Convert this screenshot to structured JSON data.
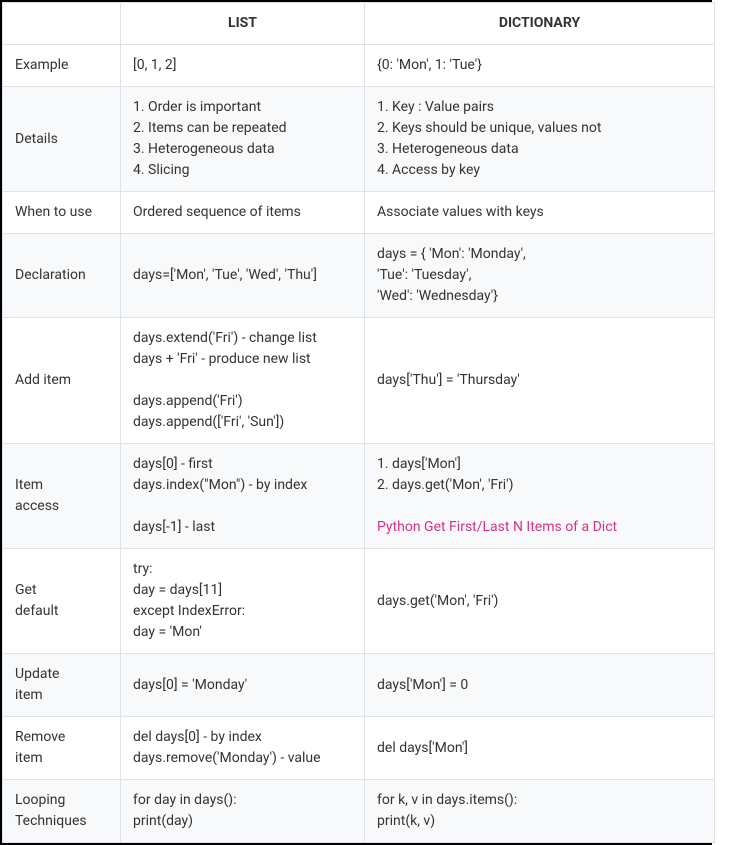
{
  "headers": {
    "col1": "",
    "col2": "LIST",
    "col3": "DICTIONARY"
  },
  "rows": [
    {
      "label": "Example",
      "list": "[0, 1, 2]",
      "dict": "{0: 'Mon', 1: 'Tue'}"
    },
    {
      "label": "Details",
      "list": "1. Order is important\n2. Items can be repeated\n3. Heterogeneous data\n4. Slicing",
      "dict": "1. Key : Value pairs\n2. Keys should be unique, values not\n3. Heterogeneous data\n4. Access by key"
    },
    {
      "label": "When to use",
      "list": "Ordered sequence of items",
      "dict": "Associate values with keys"
    },
    {
      "label": "Declaration",
      "list": "days=['Mon', 'Tue', 'Wed', 'Thu']",
      "dict": "days = { 'Mon': 'Monday',\n'Tue': 'Tuesday',\n'Wed': 'Wednesday'}"
    },
    {
      "label": "Add item",
      "list": "days.extend('Fri') - change list\ndays + 'Fri' - produce new list\n\ndays.append('Fri')\ndays.append(['Fri', 'Sun'])",
      "dict": "days['Thu'] = 'Thursday'"
    },
    {
      "label": "Item\naccess",
      "list": "days[0] - first\ndays.index(\"Mon\") - by index\n\ndays[-1] - last",
      "dict_text": "1. days['Mon']\n2. days.get('Mon', 'Fri')\n",
      "dict_link": "Python Get First/Last N Items of a Dict"
    },
    {
      "label": "Get\ndefault",
      "list": "try:\nday = days[11]\nexcept IndexError:\nday = 'Mon'",
      "dict": "days.get('Mon', 'Fri')"
    },
    {
      "label": "Update\nitem",
      "list": "days[0] = 'Monday'",
      "dict": "days['Mon'] = 0"
    },
    {
      "label": "Remove\nitem",
      "list": "del days[0] - by index\ndays.remove('Monday') - value",
      "dict": "del days['Mon']"
    },
    {
      "label": "Looping\nTechniques",
      "list": "for day in days():\nprint(day)",
      "dict": "for k, v in days.items():\nprint(k, v)"
    }
  ],
  "chart_data": {
    "type": "table",
    "title": "",
    "columns": [
      "",
      "LIST",
      "DICTIONARY"
    ],
    "rows": [
      [
        "Example",
        "[0, 1, 2]",
        "{0: 'Mon', 1: 'Tue'}"
      ],
      [
        "Details",
        "1. Order is important; 2. Items can be repeated; 3. Heterogeneous data; 4. Slicing",
        "1. Key : Value pairs; 2. Keys should be unique, values not; 3. Heterogeneous data; 4. Access by key"
      ],
      [
        "When to use",
        "Ordered sequence of items",
        "Associate values with keys"
      ],
      [
        "Declaration",
        "days=['Mon', 'Tue', 'Wed', 'Thu']",
        "days = { 'Mon': 'Monday', 'Tue': 'Tuesday', 'Wed': 'Wednesday'}"
      ],
      [
        "Add item",
        "days.extend('Fri') - change list; days + 'Fri' - produce new list; days.append('Fri'); days.append(['Fri', 'Sun'])",
        "days['Thu'] = 'Thursday'"
      ],
      [
        "Item access",
        "days[0] - first; days.index(\"Mon\") - by index; days[-1] - last",
        "1. days['Mon']; 2. days.get('Mon', 'Fri'); Python Get First/Last N Items of a Dict"
      ],
      [
        "Get default",
        "try: day = days[11] except IndexError: day = 'Mon'",
        "days.get('Mon', 'Fri')"
      ],
      [
        "Update item",
        "days[0] = 'Monday'",
        "days['Mon'] = 0"
      ],
      [
        "Remove item",
        "del days[0] - by index; days.remove('Monday') - value",
        "del days['Mon']"
      ],
      [
        "Looping Techniques",
        "for day in days(): print(day)",
        "for k, v in days.items(): print(k, v)"
      ]
    ]
  }
}
